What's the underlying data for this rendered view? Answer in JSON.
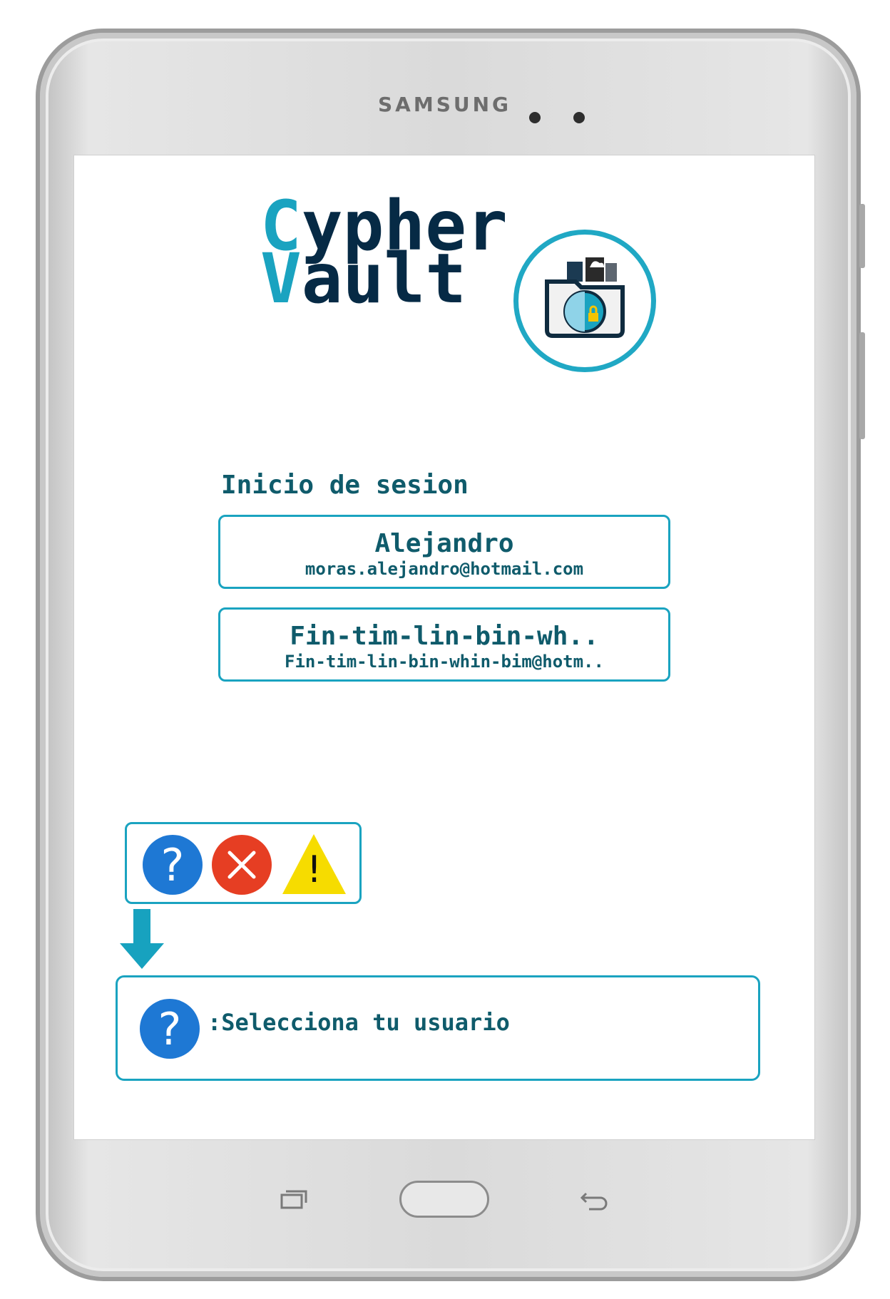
{
  "device": {
    "brand": "SAMSUNG"
  },
  "logo": {
    "line1_accent": "C",
    "line1_rest": "ypher",
    "line2_accent": "V",
    "line2_rest": "ault",
    "emblem_icon": "vault-folder-lock-icon"
  },
  "login": {
    "title": "Inicio de sesion",
    "users": [
      {
        "name": "Alejandro",
        "email": "moras.alejandro@hotmail.com"
      },
      {
        "name": "Fin-tim-lin-bin-wh..",
        "email": "Fin-tim-lin-bin-whin-bim@hotm.."
      }
    ]
  },
  "status_icons": {
    "help": "?",
    "error_icon": "close-icon",
    "warning": "!"
  },
  "message": {
    "icon": "?",
    "text": ":Selecciona tu usuario"
  },
  "colors": {
    "accent": "#1aa3c0",
    "dark_navy": "#062a45",
    "text_teal": "#0f5b6b",
    "help_blue": "#1e78d4",
    "error_red": "#e63e23",
    "warning_yellow": "#f6dc00"
  }
}
